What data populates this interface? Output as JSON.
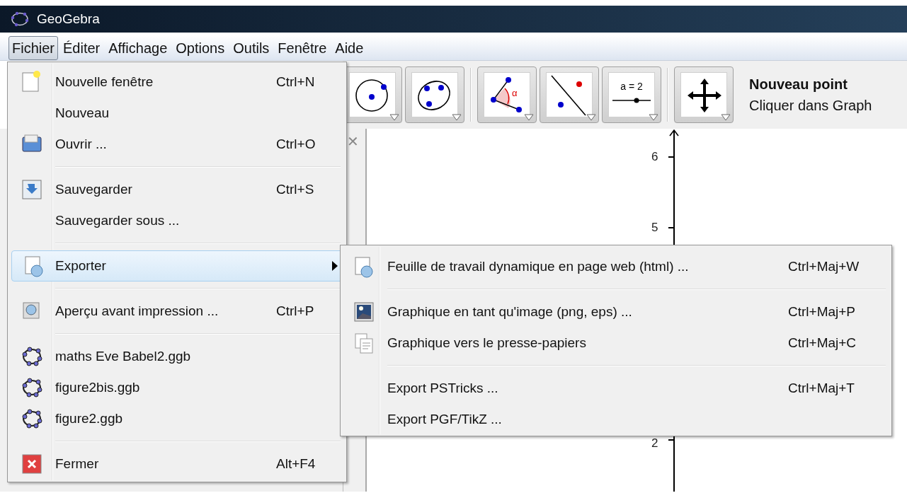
{
  "window": {
    "title": "GeoGebra"
  },
  "menu_bar": [
    {
      "label": "Fichier",
      "selected": true
    },
    {
      "label": "Éditer",
      "selected": false
    },
    {
      "label": "Affichage",
      "selected": false
    },
    {
      "label": "Options",
      "selected": false
    },
    {
      "label": "Outils",
      "selected": false
    },
    {
      "label": "Fenêtre",
      "selected": false
    },
    {
      "label": "Aide",
      "selected": false
    }
  ],
  "toolbar": {
    "tools": [
      {
        "kind": "circle"
      },
      {
        "kind": "conic"
      },
      {
        "kind": "angle",
        "label": "α"
      },
      {
        "kind": "parallel"
      },
      {
        "kind": "slider",
        "label": "a = 2"
      },
      {
        "kind": "move"
      }
    ],
    "help_title": "Nouveau point",
    "help_text": "Cliquer dans Graph"
  },
  "side_panel": {
    "close": "✕"
  },
  "graphics": {
    "y_ticks": [
      "6",
      "5",
      "2"
    ]
  },
  "file_menu": {
    "items": [
      {
        "kind": "item",
        "label": "Nouvelle fenêtre",
        "shortcut": "Ctrl+N",
        "selected": false,
        "has_submenu": false
      },
      {
        "kind": "item",
        "label": "Nouveau",
        "selected": false,
        "has_submenu": false
      },
      {
        "kind": "item",
        "label": "Ouvrir ...",
        "shortcut": "Ctrl+O",
        "selected": false,
        "has_submenu": false
      },
      {
        "kind": "separator"
      },
      {
        "kind": "item",
        "label": "Sauvegarder",
        "shortcut": "Ctrl+S",
        "selected": false,
        "has_submenu": false
      },
      {
        "kind": "item",
        "label": "Sauvegarder sous ...",
        "selected": false,
        "has_submenu": false
      },
      {
        "kind": "separator"
      },
      {
        "kind": "item",
        "label": "Exporter",
        "selected": true,
        "has_submenu": true
      },
      {
        "kind": "separator"
      },
      {
        "kind": "item",
        "label": "Aperçu avant impression ...",
        "shortcut": "Ctrl+P",
        "selected": false,
        "has_submenu": false
      },
      {
        "kind": "separator"
      },
      {
        "kind": "item",
        "label": "maths Eve Babel2.ggb",
        "selected": false,
        "has_submenu": false
      },
      {
        "kind": "item",
        "label": "figure2bis.ggb",
        "selected": false,
        "has_submenu": false
      },
      {
        "kind": "item",
        "label": "figure2.ggb",
        "selected": false,
        "has_submenu": false
      },
      {
        "kind": "separator"
      },
      {
        "kind": "item",
        "label": "Fermer",
        "shortcut": "Alt+F4",
        "selected": false,
        "has_submenu": false
      }
    ]
  },
  "export_submenu": {
    "items": [
      {
        "kind": "item",
        "label": "Feuille de travail dynamique en page web (html) ...",
        "shortcut": "Ctrl+Maj+W"
      },
      {
        "kind": "separator"
      },
      {
        "kind": "item",
        "label": "Graphique en tant qu'image (png, eps) ...",
        "shortcut": "Ctrl+Maj+P"
      },
      {
        "kind": "item",
        "label": "Graphique vers le presse-papiers",
        "shortcut": "Ctrl+Maj+C"
      },
      {
        "kind": "separator"
      },
      {
        "kind": "item",
        "label": "Export PSTricks ...",
        "shortcut": "Ctrl+Maj+T"
      },
      {
        "kind": "item",
        "label": "Export PGF/TikZ ..."
      }
    ]
  }
}
